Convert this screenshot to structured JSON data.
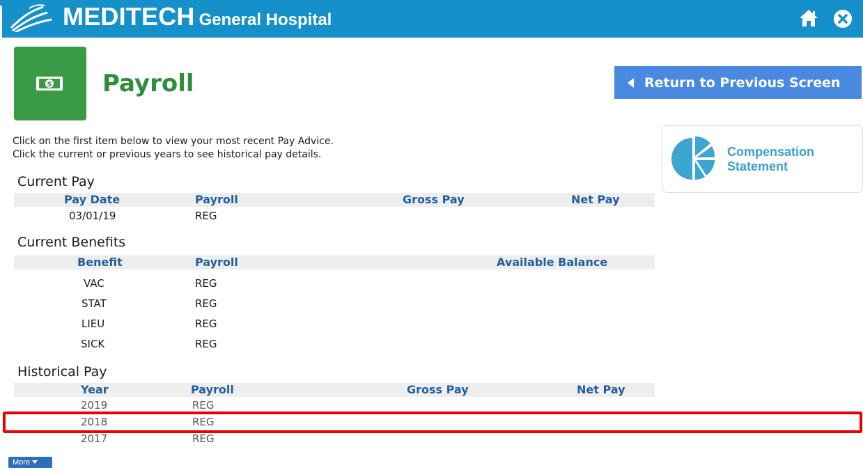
{
  "header": {
    "brand_name": "MEDITECH",
    "brand_subtitle": "General Hospital",
    "logo_icon": "wave-logo-icon",
    "home_icon": "home-icon",
    "close_icon": "close-icon",
    "bar_color": "#1590c8"
  },
  "page": {
    "title": "Payroll",
    "tile_icon": "money-icon",
    "tile_color": "#3a9b46",
    "return_button_label": "Return to Previous Screen",
    "intro_line1": "Click on the first item below to view your most recent Pay Advice.",
    "intro_line2": "Click the current or previous years to see historical pay details."
  },
  "compensation": {
    "label_line1": "Compensation",
    "label_line2": "Statement",
    "icon": "pie-chart-icon"
  },
  "current_pay": {
    "title": "Current Pay",
    "headers": [
      "Pay Date",
      "Payroll",
      "Gross Pay",
      "Net Pay"
    ],
    "rows": [
      {
        "pay_date": "03/01/19",
        "payroll": "REG",
        "gross": "",
        "net": ""
      }
    ]
  },
  "current_benefits": {
    "title": "Current Benefits",
    "headers": [
      "Benefit",
      "Payroll",
      "Available Balance"
    ],
    "rows": [
      {
        "benefit": "VAC",
        "payroll": "REG",
        "balance": ""
      },
      {
        "benefit": "STAT",
        "payroll": "REG",
        "balance": ""
      },
      {
        "benefit": "LIEU",
        "payroll": "REG",
        "balance": ""
      },
      {
        "benefit": "SICK",
        "payroll": "REG",
        "balance": ""
      }
    ]
  },
  "historical_pay": {
    "title": "Historical Pay",
    "headers": [
      "Year",
      "Payroll",
      "Gross Pay",
      "Net Pay"
    ],
    "rows": [
      {
        "year": "2019",
        "payroll": "REG",
        "gross": "",
        "net": ""
      },
      {
        "year": "2018",
        "payroll": "REG",
        "gross": "",
        "net": ""
      },
      {
        "year": "2017",
        "payroll": "REG",
        "gross": "",
        "net": ""
      }
    ],
    "highlighted_year": "2018"
  },
  "more_button_label": "More"
}
